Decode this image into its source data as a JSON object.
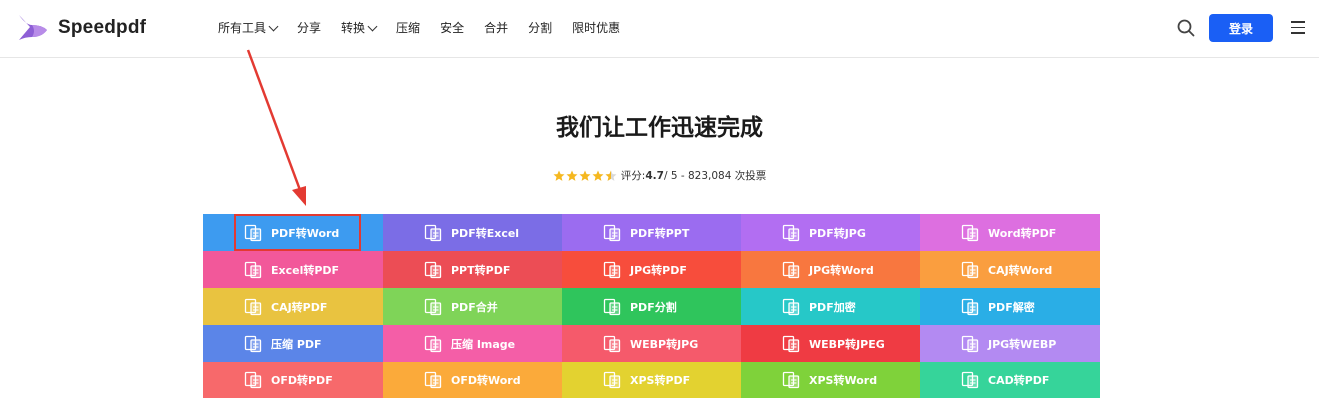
{
  "header": {
    "logo_text": "Speedpdf",
    "nav": [
      {
        "label": "所有工具",
        "dropdown": true
      },
      {
        "label": "分享",
        "dropdown": false
      },
      {
        "label": "转换",
        "dropdown": true
      },
      {
        "label": "压缩",
        "dropdown": false
      },
      {
        "label": "安全",
        "dropdown": false
      },
      {
        "label": "合并",
        "dropdown": false
      },
      {
        "label": "分割",
        "dropdown": false
      },
      {
        "label": "限时优惠",
        "dropdown": false
      }
    ],
    "login_label": "登录"
  },
  "hero": {
    "title": "我们让工作迅速完成",
    "rating_prefix": "评分: ",
    "rating_value": "4.7",
    "rating_suffix": " / 5 - 823,084 次投票",
    "stars": 4.5
  },
  "colors": {
    "brand_blue": "#1a5ff5",
    "annotation_red": "#e33a32"
  },
  "tools": [
    {
      "label": "PDF转Word",
      "color": "#3d9bf0"
    },
    {
      "label": "PDF转Excel",
      "color": "#7b6de6"
    },
    {
      "label": "PDF转PPT",
      "color": "#9b6cf0"
    },
    {
      "label": "PDF转JPG",
      "color": "#b26ef2"
    },
    {
      "label": "Word转PDF",
      "color": "#dd6fe0"
    },
    {
      "label": "Excel转PDF",
      "color": "#f2589a"
    },
    {
      "label": "PPT转PDF",
      "color": "#ec4d55"
    },
    {
      "label": "JPG转PDF",
      "color": "#f74d3c"
    },
    {
      "label": "JPG转Word",
      "color": "#f8773f"
    },
    {
      "label": "CAJ转Word",
      "color": "#fa9e3f"
    },
    {
      "label": "CAJ转PDF",
      "color": "#e9c340"
    },
    {
      "label": "PDF合并",
      "color": "#7fd458"
    },
    {
      "label": "PDF分割",
      "color": "#2fc55c"
    },
    {
      "label": "PDF加密",
      "color": "#26c8c8"
    },
    {
      "label": "PDF解密",
      "color": "#2aaee6"
    },
    {
      "label": "压缩 PDF",
      "color": "#5b85e8"
    },
    {
      "label": "压缩 Image",
      "color": "#f45ea7"
    },
    {
      "label": "WEBP转JPG",
      "color": "#f55a6b"
    },
    {
      "label": "WEBP转JPEG",
      "color": "#ef3b43"
    },
    {
      "label": "JPG转WEBP",
      "color": "#b38af2"
    },
    {
      "label": "OFD转PDF",
      "color": "#f7696b"
    },
    {
      "label": "OFD转Word",
      "color": "#fbaa3a"
    },
    {
      "label": "XPS转PDF",
      "color": "#e3d230"
    },
    {
      "label": "XPS转Word",
      "color": "#7fd23a"
    },
    {
      "label": "CAD转PDF",
      "color": "#36d49a"
    }
  ]
}
